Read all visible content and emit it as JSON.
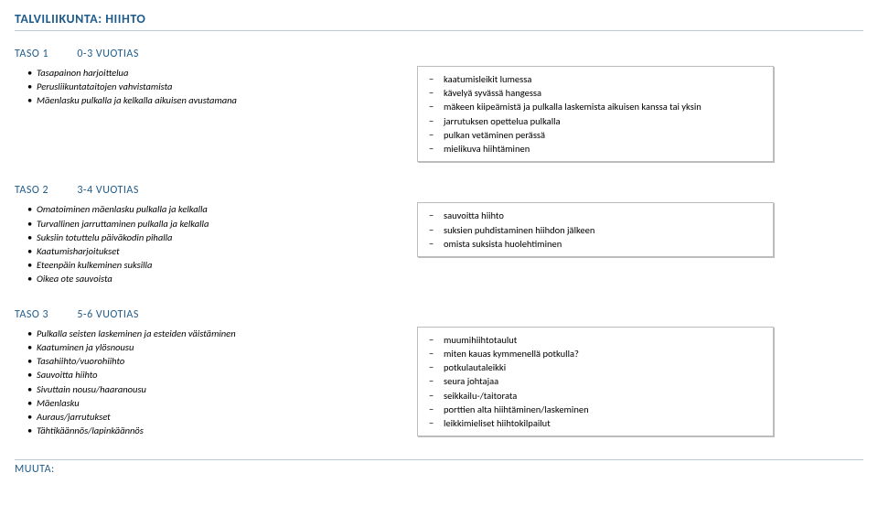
{
  "title": "TALVILIIKUNTA: HIIHTO",
  "levels": [
    {
      "name": "TASO 1",
      "age": "0-3 VUOTIAS",
      "left": [
        "Tasapainon harjoittelua",
        "Perusliikuntataitojen vahvistamista",
        "Mäenlasku pulkalla ja kelkalla aikuisen avustamana"
      ],
      "right": [
        "kaatumisleikit lumessa",
        "kävelyä syvässä hangessa",
        "mäkeen kiipeämistä ja pulkalla laskemista aikuisen kanssa tai yksin",
        "jarrutuksen opettelua pulkalla",
        "pulkan vetäminen perässä",
        "mielikuva hiihtäminen"
      ]
    },
    {
      "name": "TASO 2",
      "age": "3-4 VUOTIAS",
      "left": [
        "Omatoiminen mäenlasku pulkalla ja kelkalla",
        "Turvallinen jarruttaminen pulkalla ja kelkalla",
        "Suksiin totuttelu päiväkodin pihalla",
        "Kaatumisharjoitukset",
        "Eteenpäin kulkeminen suksilla",
        "Oikea ote sauvoista"
      ],
      "right": [
        "sauvoitta hiihto",
        "suksien puhdistaminen hiihdon jälkeen",
        "omista suksista huolehtiminen"
      ]
    },
    {
      "name": "TASO 3",
      "age": "5-6 VUOTIAS",
      "left": [
        "Pulkalla seisten laskeminen ja esteiden väistäminen",
        "Kaatuminen ja ylösnousu",
        "Tasahiihto/vuorohiihto",
        "Sauvoitta hiihto",
        "Sivuttain nousu/haaranousu",
        "Mäenlasku",
        "Auraus/jarrutukset",
        "Tähtikäännös/lapinkäännös"
      ],
      "right": [
        "muumihiihtotaulut",
        "miten kauas kymmenellä potkulla?",
        "potkulautaleikki",
        "seura johtajaa",
        "seikkailu-/taitorata",
        "porttien alta hiihtäminen/laskeminen",
        "leikkimieliset hiihtokilpailut"
      ]
    }
  ],
  "footer": "MUUTA:"
}
